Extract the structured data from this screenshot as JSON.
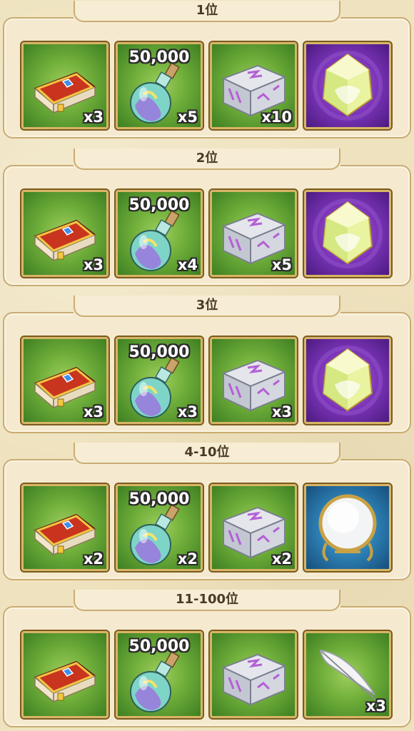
{
  "ranks": [
    {
      "label": "1位",
      "items": [
        {
          "icon": "book-icon",
          "bg": "green",
          "qty": "x3"
        },
        {
          "icon": "potion-icon",
          "bg": "green",
          "amount": "50,000",
          "qty": "x5"
        },
        {
          "icon": "chest-icon",
          "bg": "green",
          "qty": "x10"
        },
        {
          "icon": "crystal-icon",
          "bg": "purple"
        }
      ]
    },
    {
      "label": "2位",
      "items": [
        {
          "icon": "book-icon",
          "bg": "green",
          "qty": "x3"
        },
        {
          "icon": "potion-icon",
          "bg": "green",
          "amount": "50,000",
          "qty": "x4"
        },
        {
          "icon": "chest-icon",
          "bg": "green",
          "qty": "x5"
        },
        {
          "icon": "crystal-icon",
          "bg": "purple"
        }
      ]
    },
    {
      "label": "3位",
      "items": [
        {
          "icon": "book-icon",
          "bg": "green",
          "qty": "x3"
        },
        {
          "icon": "potion-icon",
          "bg": "green",
          "amount": "50,000",
          "qty": "x3"
        },
        {
          "icon": "chest-icon",
          "bg": "green",
          "qty": "x3"
        },
        {
          "icon": "crystal-icon",
          "bg": "purple"
        }
      ]
    },
    {
      "label": "4-10位",
      "items": [
        {
          "icon": "book-icon",
          "bg": "green",
          "qty": "x2"
        },
        {
          "icon": "potion-icon",
          "bg": "green",
          "amount": "50,000",
          "qty": "x2"
        },
        {
          "icon": "chest-icon",
          "bg": "green",
          "qty": "x2"
        },
        {
          "icon": "mirror-icon",
          "bg": "blue"
        }
      ]
    },
    {
      "label": "11-100位",
      "items": [
        {
          "icon": "book-icon",
          "bg": "green"
        },
        {
          "icon": "potion-icon",
          "bg": "green",
          "amount": "50,000"
        },
        {
          "icon": "chest-icon",
          "bg": "green"
        },
        {
          "icon": "feather-icon",
          "bg": "green",
          "qty": "x3"
        }
      ]
    }
  ]
}
